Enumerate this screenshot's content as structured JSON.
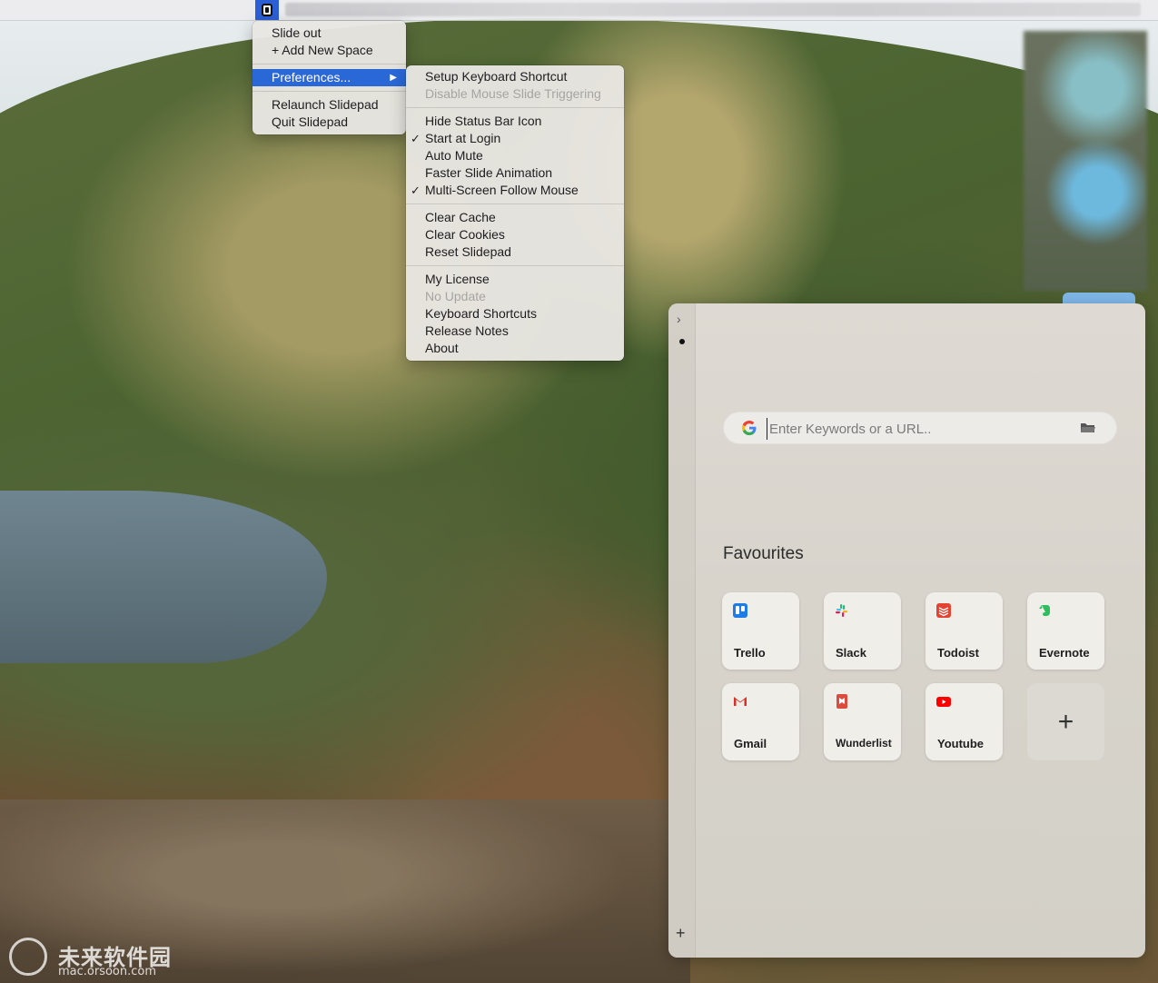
{
  "menubar": {
    "status_icon": "slidepad-status-icon"
  },
  "main_menu": {
    "items": [
      {
        "label": "Slide out"
      },
      {
        "label": "+ Add New Space"
      },
      {
        "label": "Preferences...",
        "selected": true,
        "has_submenu": true
      },
      {
        "label": "Relaunch Slidepad"
      },
      {
        "label": "Quit Slidepad"
      }
    ]
  },
  "preferences_menu": {
    "items": [
      {
        "label": "Setup Keyboard Shortcut"
      },
      {
        "label": "Disable Mouse Slide Triggering",
        "disabled": true
      },
      {
        "label": "Hide Status Bar Icon"
      },
      {
        "label": "Start at Login",
        "checked": true
      },
      {
        "label": "Auto Mute"
      },
      {
        "label": "Faster Slide Animation"
      },
      {
        "label": "Multi-Screen Follow Mouse",
        "checked": true
      },
      {
        "label": "Clear Cache"
      },
      {
        "label": "Clear Cookies"
      },
      {
        "label": "Reset Slidepad"
      },
      {
        "label": "My License"
      },
      {
        "label": "No Update",
        "disabled": true
      },
      {
        "label": "Keyboard Shortcuts"
      },
      {
        "label": "Release Notes"
      },
      {
        "label": "About"
      }
    ]
  },
  "panel": {
    "search": {
      "placeholder": "Enter Keywords or a URL..",
      "engine_icon": "google-icon",
      "folder_icon": "folder-icon"
    },
    "favourites_title": "Favourites",
    "favourites": [
      {
        "label": "Trello",
        "icon": "trello-icon",
        "color": "#1f7be6"
      },
      {
        "label": "Slack",
        "icon": "slack-icon",
        "color": "#e01e5a"
      },
      {
        "label": "Todoist",
        "icon": "todoist-icon",
        "color": "#e44332"
      },
      {
        "label": "Evernote",
        "icon": "evernote-icon",
        "color": "#2dbe60"
      },
      {
        "label": "Gmail",
        "icon": "gmail-icon",
        "color": "#d93025"
      },
      {
        "label": "Wunderlist",
        "icon": "wunderlist-icon",
        "color": "#db4c3f"
      },
      {
        "label": "Youtube",
        "icon": "youtube-icon",
        "color": "#ff0000"
      }
    ],
    "add_tile": "+",
    "rail_chevron": "›",
    "rail_add": "+"
  },
  "watermark": {
    "cn": "未来软件园",
    "url": "mac.orsoon.com"
  }
}
